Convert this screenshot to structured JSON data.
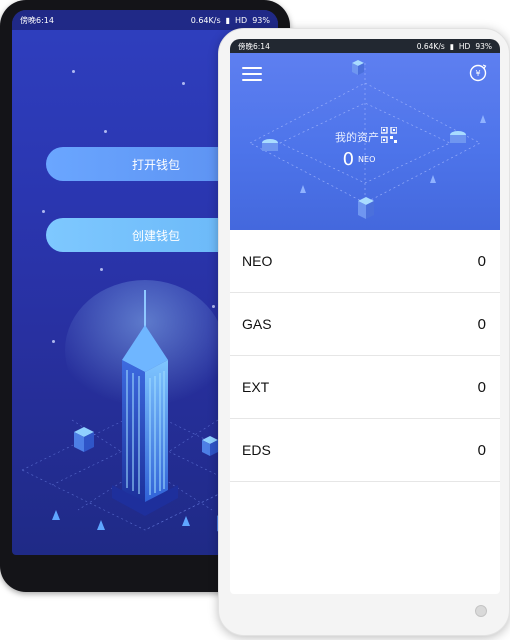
{
  "back_phone": {
    "status": {
      "time": "傍晚6:14",
      "speed": "0.64K/s",
      "network": "HD",
      "battery": "93%"
    },
    "buttons": {
      "open_wallet": "打开钱包",
      "create_wallet": "创建钱包"
    }
  },
  "front_phone": {
    "status": {
      "time": "傍晚6:14",
      "speed": "0.64K/s",
      "network": "HD",
      "battery": "93%"
    },
    "header": {
      "assets_label": "我的资产",
      "total_value": "0",
      "total_unit": "NEO",
      "icons": [
        "menu-icon",
        "currency-switch-icon",
        "qr-code-icon"
      ]
    },
    "tokens": [
      {
        "symbol": "NEO",
        "balance": "0"
      },
      {
        "symbol": "GAS",
        "balance": "0"
      },
      {
        "symbol": "EXT",
        "balance": "0"
      },
      {
        "symbol": "EDS",
        "balance": "0"
      }
    ]
  },
  "colors": {
    "accent": "#4d74ea",
    "back_bg": "#2a36b0",
    "open_button": "#5b8ff0",
    "create_button": "#68b6f7"
  }
}
